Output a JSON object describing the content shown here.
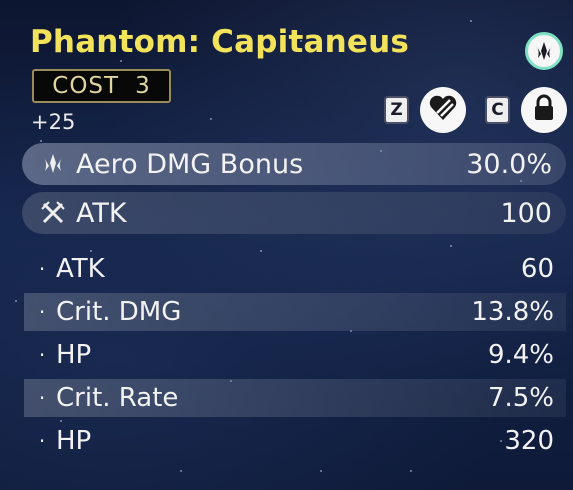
{
  "echo": {
    "name": "Phantom: Capitaneus",
    "cost_label": "COST",
    "cost_value": "3",
    "level": "+25",
    "rarity_ring_color": "#7fe0c4",
    "title_color": "#f3e35a"
  },
  "controls": {
    "favorite_key": "Z",
    "lock_key": "C",
    "favorite_icon": "heart-slash-icon",
    "lock_icon": "lock-icon"
  },
  "main_stats": [
    {
      "icon": "aero-icon",
      "name": "Aero DMG Bonus",
      "value": "30.0%"
    },
    {
      "icon": "atk-swords-icon",
      "name": "ATK",
      "value": "100"
    }
  ],
  "sub_stats": [
    {
      "name": "ATK",
      "value": "60"
    },
    {
      "name": "Crit. DMG",
      "value": "13.8%"
    },
    {
      "name": "HP",
      "value": "9.4%"
    },
    {
      "name": "Crit. Rate",
      "value": "7.5%"
    },
    {
      "name": "HP",
      "value": "320"
    }
  ],
  "bullet": "·"
}
